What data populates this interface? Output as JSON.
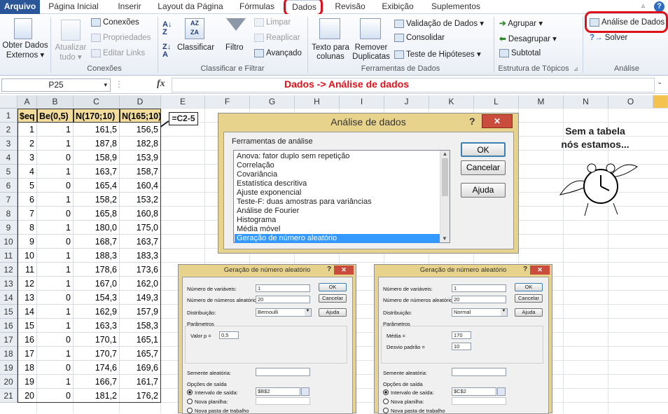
{
  "tabs": [
    "Arquivo",
    "Página Inicial",
    "Inserir",
    "Layout da Página",
    "Fórmulas",
    "Dados",
    "Revisão",
    "Exibição",
    "Suplementos"
  ],
  "ribbon": {
    "obter": "Obter Dados",
    "externos": "Externos",
    "atualizar": "Atualizar",
    "tudo": "tudo",
    "conexoes": "Conexões",
    "propriedades": "Propriedades",
    "editar_links": "Editar Links",
    "classificar": "Classificar",
    "filtro": "Filtro",
    "limpar": "Limpar",
    "reaplicar": "Reaplicar",
    "avancado": "Avançado",
    "texto_para": "Texto para",
    "colunas": "colunas",
    "remover": "Remover",
    "duplicatas": "Duplicatas",
    "validacao": "Validação de Dados",
    "consolidar": "Consolidar",
    "teste": "Teste de Hipóteses",
    "agrupar": "Agrupar",
    "desagrupar": "Desagrupar",
    "subtotal": "Subtotal",
    "analise": "Análise de Dados",
    "solver": "Solver",
    "groups": {
      "conexoes": "Conexões",
      "classificar": "Classificar e Filtrar",
      "ferramentas": "Ferramentas de Dados",
      "estrutura": "Estrutura de Tópicos",
      "analise": "Análise"
    }
  },
  "namebox": "P25",
  "fx": "fx",
  "annotation": "Dados -> Análise de dados",
  "columns": [
    "A",
    "B",
    "C",
    "D",
    "E",
    "F",
    "G",
    "H",
    "I",
    "J",
    "K",
    "L",
    "M",
    "N",
    "O"
  ],
  "headers": [
    "$eq",
    "Be(0,5)",
    "N(170;10)",
    "N(165;10)"
  ],
  "rows": [
    [
      "1",
      "1",
      "161,5",
      "156,5"
    ],
    [
      "2",
      "1",
      "187,8",
      "182,8"
    ],
    [
      "3",
      "0",
      "158,9",
      "153,9"
    ],
    [
      "4",
      "1",
      "163,7",
      "158,7"
    ],
    [
      "5",
      "0",
      "165,4",
      "160,4"
    ],
    [
      "6",
      "1",
      "158,2",
      "153,2"
    ],
    [
      "7",
      "0",
      "165,8",
      "160,8"
    ],
    [
      "8",
      "1",
      "180,0",
      "175,0"
    ],
    [
      "9",
      "0",
      "168,7",
      "163,7"
    ],
    [
      "10",
      "1",
      "188,3",
      "183,3"
    ],
    [
      "11",
      "1",
      "178,6",
      "173,6"
    ],
    [
      "12",
      "1",
      "167,0",
      "162,0"
    ],
    [
      "13",
      "0",
      "154,3",
      "149,3"
    ],
    [
      "14",
      "1",
      "162,9",
      "157,9"
    ],
    [
      "15",
      "1",
      "163,3",
      "158,3"
    ],
    [
      "16",
      "0",
      "170,1",
      "165,1"
    ],
    [
      "17",
      "1",
      "170,7",
      "165,7"
    ],
    [
      "18",
      "0",
      "174,6",
      "169,6"
    ],
    [
      "19",
      "1",
      "166,7",
      "161,7"
    ],
    [
      "20",
      "0",
      "181,2",
      "176,2"
    ]
  ],
  "formula_note": "=C2-5",
  "side_text": [
    "Sem a tabela",
    "nós estamos..."
  ],
  "main_dialog": {
    "title": "Análise de dados",
    "help": "?",
    "close": "✕",
    "label": "Ferramentas de análise",
    "items": [
      "Anova: fator duplo sem repetição",
      "Correlação",
      "Covariância",
      "Estatística descritiva",
      "Ajuste exponencial",
      "Teste-F: duas amostras para variâncias",
      "Análise de Fourier",
      "Histograma",
      "Média móvel",
      "Geração de número aleatório"
    ],
    "ok": "OK",
    "cancel": "Cancelar",
    "help_btn": "Ajuda"
  },
  "dlg1": {
    "title": "Geração de número aleatório",
    "num_var": "Número de variáveis:",
    "num_var_val": "1",
    "num_rand": "Número de números aleatórios:",
    "num_rand_val": "20",
    "dist": "Distribuição:",
    "dist_val": "Bernoulli",
    "params": "Parâmetros",
    "p1": "Valor p =",
    "p1_val": "0,5",
    "seed": "Semente aleatória:",
    "out": "Opções de saída",
    "range": "Intervalo de saída:",
    "range_val": "$B$2",
    "new_sheet": "Nova planilha:",
    "new_book": "Nova pasta de trabalho",
    "ok": "OK",
    "cancel": "Cancelar",
    "help": "Ajuda"
  },
  "dlg2": {
    "title": "Geração de número aleatório",
    "num_var": "Número de variáveis:",
    "num_var_val": "1",
    "num_rand": "Número de números aleatórios:",
    "num_rand_val": "20",
    "dist": "Distribuição:",
    "dist_val": "Normal",
    "params": "Parâmetros",
    "p1": "Média =",
    "p1_val": "170",
    "p2": "Desvio padrão =",
    "p2_val": "10",
    "seed": "Semente aleatória:",
    "out": "Opções de saída",
    "range": "Intervalo de saída:",
    "range_val": "$C$2",
    "new_sheet": "Nova planilha:",
    "new_book": "Nova pasta de trabalho",
    "ok": "OK",
    "cancel": "Cancelar",
    "help": "Ajuda"
  }
}
